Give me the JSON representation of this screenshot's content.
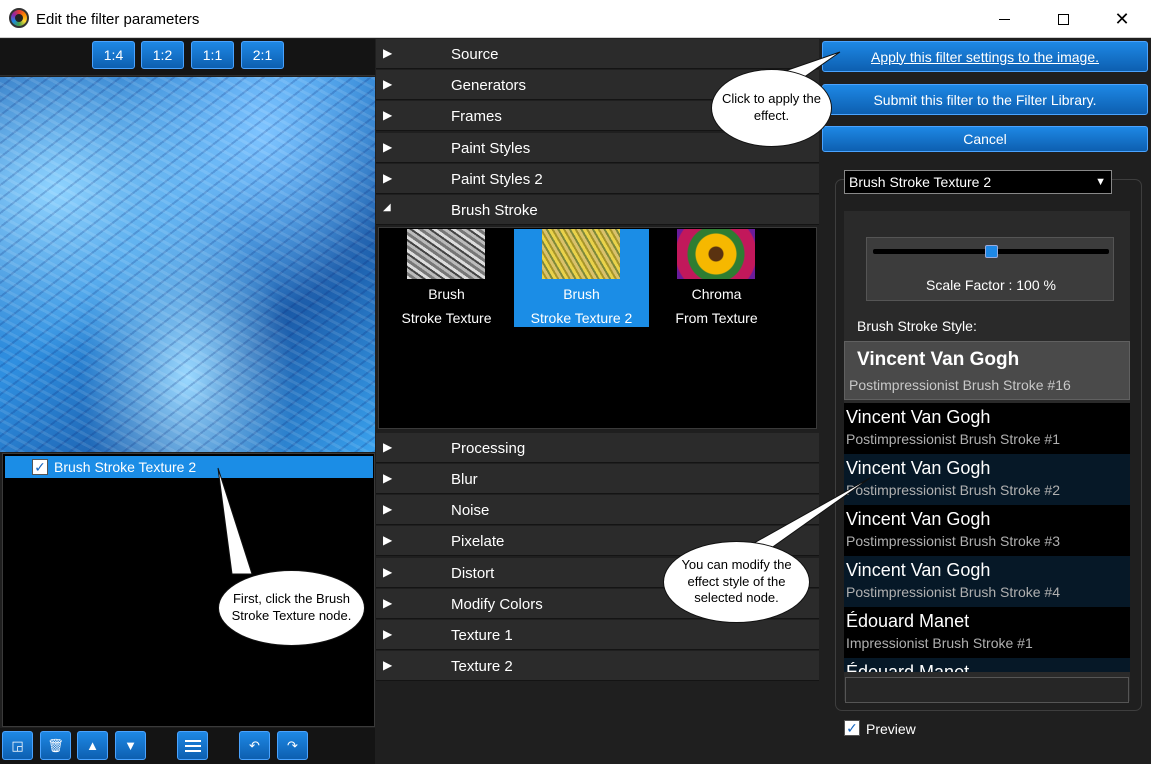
{
  "window": {
    "title": "Edit the filter parameters"
  },
  "zoom": [
    "1:4",
    "1:2",
    "1:1",
    "2:1"
  ],
  "tree": {
    "node_label": "Brush Stroke Texture 2",
    "checked": "✓"
  },
  "categories": {
    "source": "Source",
    "generators": "Generators",
    "frames": "Frames",
    "paint_styles": "Paint Styles",
    "paint_styles_2": "Paint Styles 2",
    "brush_stroke": "Brush Stroke",
    "processing": "Processing",
    "blur": "Blur",
    "noise": "Noise",
    "pixelate": "Pixelate",
    "distort": "Distort",
    "modify_colors": "Modify Colors",
    "texture_1": "Texture 1",
    "texture_2": "Texture 2"
  },
  "gallery": [
    {
      "line1": "Brush",
      "line2": "Stroke Texture"
    },
    {
      "line1": "Brush",
      "line2": "Stroke Texture 2"
    },
    {
      "line1": "Chroma",
      "line2": "From Texture"
    }
  ],
  "actions": {
    "apply": "Apply this filter settings to the image.",
    "submit": "Submit this filter to the Filter Library.",
    "cancel": "Cancel"
  },
  "settings": {
    "filter_select": "Brush Stroke Texture 2",
    "scale_label": "Scale Factor : 100 %",
    "scale_value": 100,
    "style_label": "Brush Stroke Style:",
    "selected_style": {
      "name": "Vincent Van Gogh",
      "sub": "Postimpressionist Brush Stroke #16"
    },
    "styles": [
      {
        "name": "Vincent Van Gogh",
        "sub": "Postimpressionist Brush Stroke #1"
      },
      {
        "name": "Vincent Van Gogh",
        "sub": "Postimpressionist Brush Stroke #2"
      },
      {
        "name": "Vincent Van Gogh",
        "sub": "Postimpressionist Brush Stroke #3"
      },
      {
        "name": "Vincent Van Gogh",
        "sub": "Postimpressionist Brush Stroke #4"
      },
      {
        "name": "Édouard Manet",
        "sub": "Impressionist Brush Stroke #1"
      },
      {
        "name": "Édouard Manet",
        "sub": ""
      }
    ],
    "preview": "Preview",
    "preview_checked": "✓"
  },
  "callouts": {
    "apply": "Click to apply the effect.",
    "style": "You can modify the effect style of the selected node.",
    "node": "First, click the Brush Stroke Texture node."
  },
  "colors": {
    "accent": "#1b8de6",
    "button": "#1e88e5",
    "panel": "#2b2b2b",
    "background": "#1f1f1f"
  },
  "icons": {
    "arrow_right": "▶",
    "arrow_down": "◢",
    "select_arrow": "▼",
    "up": "▲",
    "down": "▼",
    "undo": "↶",
    "redo": "↷",
    "close": "✕",
    "delete": "🗑",
    "new": "◲"
  }
}
